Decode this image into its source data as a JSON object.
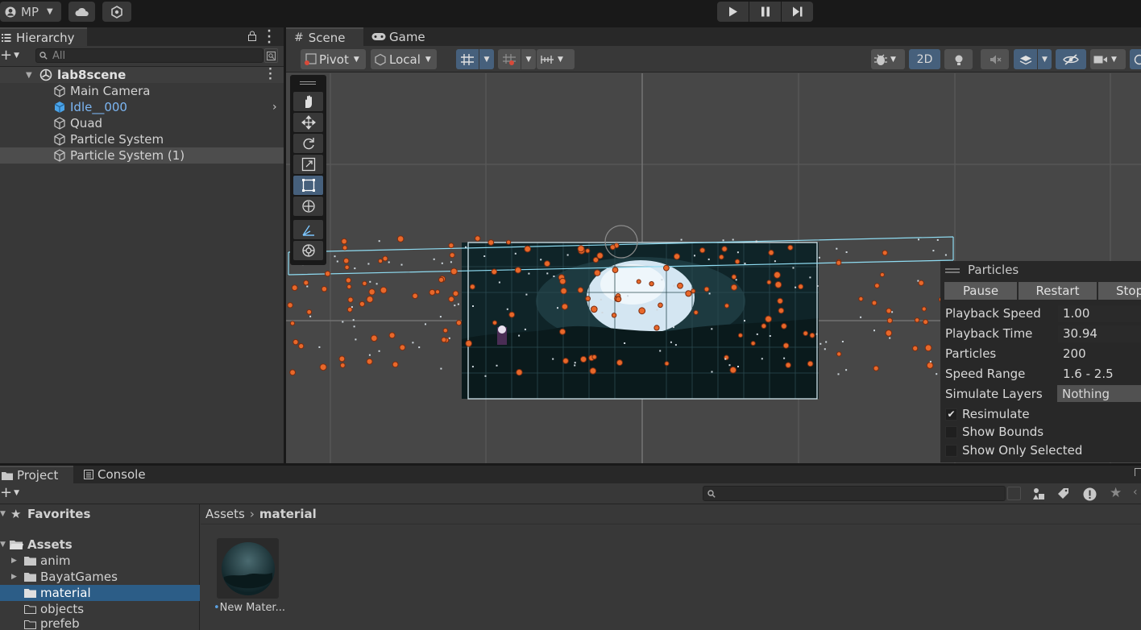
{
  "topbar": {
    "account_label": "MP",
    "icons": [
      "account-icon",
      "cloud-icon",
      "collab-icon",
      "play-icon",
      "pause-icon",
      "step-icon"
    ]
  },
  "hierarchy": {
    "tab_label": "Hierarchy",
    "search_placeholder": "All",
    "scene_name": "lab8scene",
    "items": [
      {
        "label": "Main Camera"
      },
      {
        "label": "Idle__000"
      },
      {
        "label": "Quad"
      },
      {
        "label": "Particle System"
      },
      {
        "label": "Particle System (1)"
      }
    ]
  },
  "scene": {
    "tabs": [
      {
        "label": "Scene"
      },
      {
        "label": "Game"
      }
    ],
    "pivot_label": "Pivot",
    "local_label": "Local",
    "mode_2d_label": "2D"
  },
  "particles_panel": {
    "title": "Particles",
    "buttons": {
      "pause": "Pause",
      "restart": "Restart",
      "stop": "Stop"
    },
    "fields": [
      {
        "label": "Playback Speed",
        "value": "1.00"
      },
      {
        "label": "Playback Time",
        "value": "30.94"
      },
      {
        "label": "Particles",
        "value": "200"
      },
      {
        "label": "Speed Range",
        "value": "1.6 - 2.5"
      },
      {
        "label": "Simulate Layers",
        "value": "Nothing"
      }
    ],
    "checkboxes": [
      {
        "label": "Resimulate",
        "checked": true
      },
      {
        "label": "Show Bounds",
        "checked": false
      },
      {
        "label": "Show Only Selected",
        "checked": false
      }
    ]
  },
  "project": {
    "tabs": [
      {
        "label": "Project"
      },
      {
        "label": "Console"
      }
    ],
    "favorites_label": "Favorites",
    "assets_label": "Assets",
    "folders": [
      {
        "label": "anim"
      },
      {
        "label": "BayatGames"
      },
      {
        "label": "material"
      },
      {
        "label": "objects"
      },
      {
        "label": "prefeb"
      }
    ],
    "breadcrumb": {
      "root": "Assets",
      "current": "material"
    },
    "asset_item": {
      "label": "New Mater..."
    }
  },
  "colors": {
    "accent": "#46607c",
    "selection": "#2c5d87",
    "highlight_text": "#7cb6f3",
    "particle": "#e8682a"
  }
}
